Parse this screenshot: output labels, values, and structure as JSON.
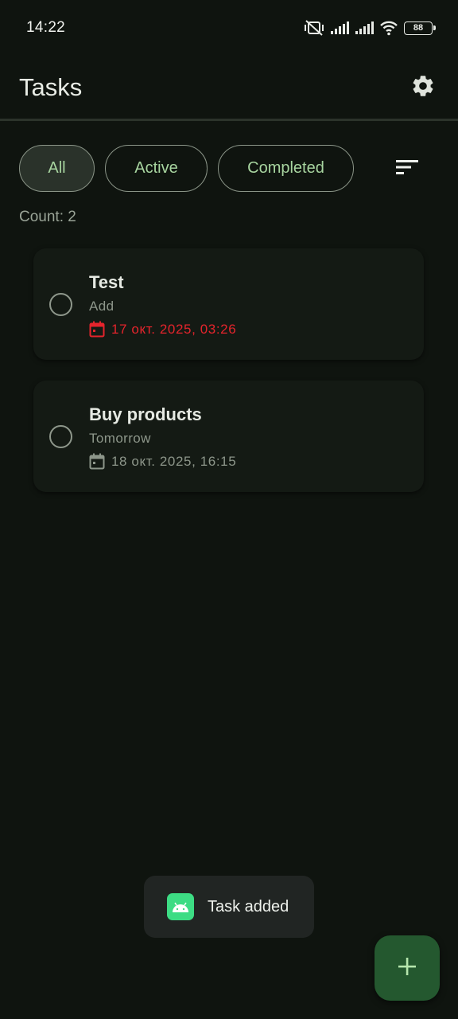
{
  "status_bar": {
    "time": "14:22",
    "battery": "88",
    "icons": [
      "silent-vibrate-icon",
      "signal-icon",
      "signal-icon",
      "wifi-icon",
      "battery-icon"
    ]
  },
  "app_bar": {
    "title": "Tasks",
    "settings_icon": "gear-icon"
  },
  "filters": {
    "chips": [
      {
        "label": "All",
        "selected": true
      },
      {
        "label": "Active",
        "selected": false
      },
      {
        "label": "Completed",
        "selected": false
      }
    ],
    "sort_icon": "sort-icon"
  },
  "count_label": "Count: 2",
  "tasks": [
    {
      "title": "Test",
      "description": "Add",
      "date": "17 окт. 2025, 03:26",
      "overdue": true,
      "completed": false
    },
    {
      "title": "Buy products",
      "description": "Tomorrow",
      "date": "18 окт. 2025, 16:15",
      "overdue": false,
      "completed": false
    }
  ],
  "toast": {
    "text": "Task added",
    "icon": "android-app-icon"
  },
  "fab": {
    "icon": "plus-icon"
  },
  "colors": {
    "background": "#0f140f",
    "accent": "#a8d5a0",
    "overdue": "#e5242c",
    "fab": "#24582f"
  }
}
